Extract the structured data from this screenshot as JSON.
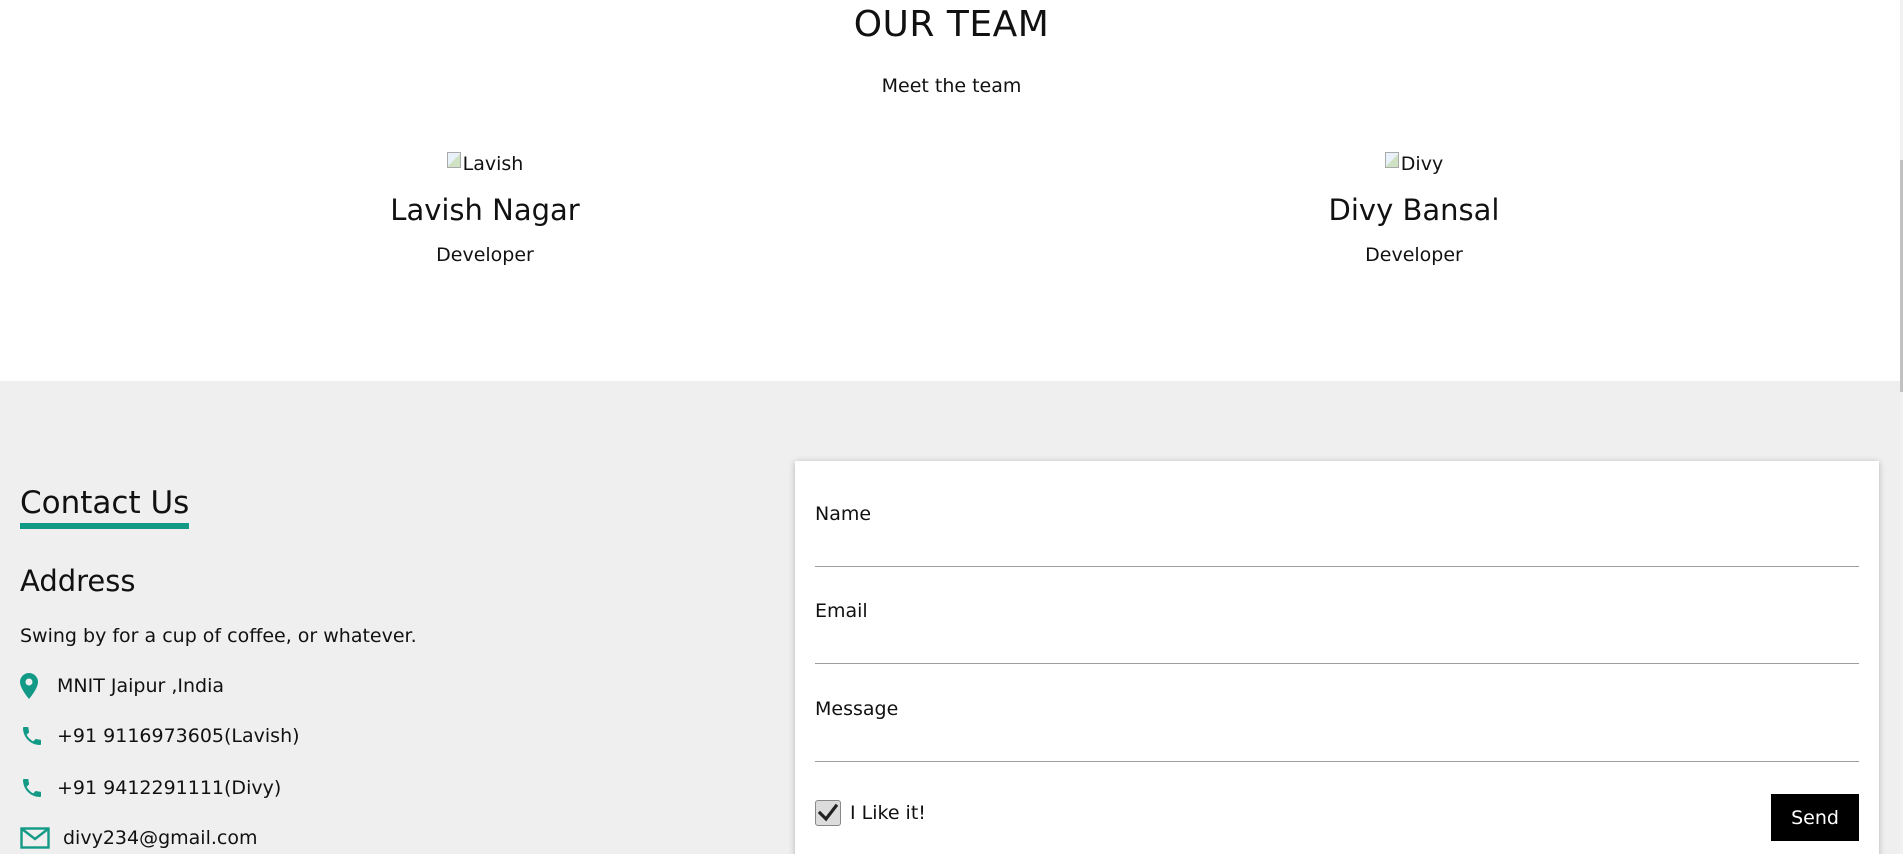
{
  "top_progress": {
    "fraction": 0.065
  },
  "team": {
    "title": "OUR TEAM",
    "subtitle": "Meet the team",
    "members": [
      {
        "img_alt": "Lavish",
        "name": "Lavish Nagar",
        "role": "Developer"
      },
      {
        "img_alt": "Divy",
        "name": "Divy Bansal",
        "role": "Developer"
      }
    ]
  },
  "contact": {
    "heading": "Contact Us",
    "address_heading": "Address",
    "address_text": "Swing by for a cup of coffee, or whatever.",
    "location": "MNIT Jaipur ,India",
    "phones": [
      "+91 9116973605(Lavish)",
      "+91 9412291111(Divy)"
    ],
    "email": "divy234@gmail.com"
  },
  "form": {
    "name_label": "Name",
    "email_label": "Email",
    "message_label": "Message",
    "checkbox_label": "I Like it!",
    "checkbox_checked": true,
    "send_label": "Send"
  },
  "colors": {
    "accent": "#139a86",
    "section_bg": "#efefef"
  },
  "icons": [
    "map-marker-icon",
    "phone-icon",
    "envelope-icon",
    "checkmark-icon",
    "broken-image-icon"
  ]
}
